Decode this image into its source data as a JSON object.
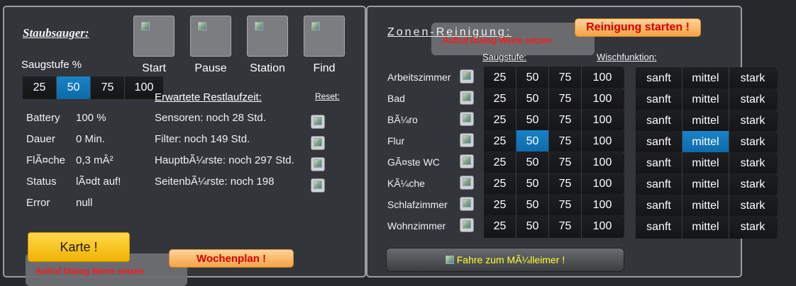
{
  "left": {
    "title": "Staubsauger:",
    "controls": [
      {
        "id": "start",
        "label": "Start"
      },
      {
        "id": "pause",
        "label": "Pause"
      },
      {
        "id": "station",
        "label": "Station"
      },
      {
        "id": "find",
        "label": "Find"
      }
    ],
    "suction_label": "Saugstufe %",
    "suction_options": [
      "25",
      "50",
      "75",
      "100"
    ],
    "suction_selected": "50",
    "stats": [
      {
        "label": "Battery",
        "value": "100 %"
      },
      {
        "label": "Dauer",
        "value": "0 Min."
      },
      {
        "label": "FlÃ¤che",
        "value": "0,3 mÂ²"
      },
      {
        "label": "Status",
        "value": "lÃ¤dt auf!"
      },
      {
        "label": "Error",
        "value": "null"
      }
    ],
    "remaining_title": "Erwartete Restlaufzeit:",
    "reset_label": "Reset:",
    "remaining": [
      "Sensoren: noch 28 Std.",
      "Filter: noch 149 Std.",
      "HauptbÃ¼rste: noch 297 Std.",
      "SeitenbÃ¼rste: noch 198"
    ],
    "map_button": "Karte !",
    "weekplan_button": "Wochenplan !",
    "dialog_text": "Aufruf Dialog Werte setzen"
  },
  "right": {
    "title": "Zonen-Reinigung:",
    "start_button": "Reinigung starten !",
    "dialog_text": "Aufruf Dialog Werte setzen",
    "suction_header": "Saugstufe:",
    "mop_header": "Wischfunktion:",
    "suction_options": [
      "25",
      "50",
      "75",
      "100"
    ],
    "mop_options": [
      "sanft",
      "mittel",
      "stark"
    ],
    "rooms": [
      {
        "name": "Arbeitszimmer",
        "suction": "",
        "mop": ""
      },
      {
        "name": "Bad",
        "suction": "",
        "mop": ""
      },
      {
        "name": "BÃ¼ro",
        "suction": "",
        "mop": ""
      },
      {
        "name": "Flur",
        "suction": "50",
        "mop": "mittel"
      },
      {
        "name": "GÃ¤ste WC",
        "suction": "",
        "mop": ""
      },
      {
        "name": "KÃ¼che",
        "suction": "",
        "mop": ""
      },
      {
        "name": "Schlafzimmer",
        "suction": "",
        "mop": ""
      },
      {
        "name": "Wohnzimmer",
        "suction": "",
        "mop": ""
      }
    ],
    "dump_button": "Fahre zum MÃ¼lleimer !"
  },
  "colors": {
    "accent_selected": "#1478b8",
    "button_yellow": "#f5c010",
    "button_orange": "#f7b565",
    "alert_red": "#e00000"
  }
}
